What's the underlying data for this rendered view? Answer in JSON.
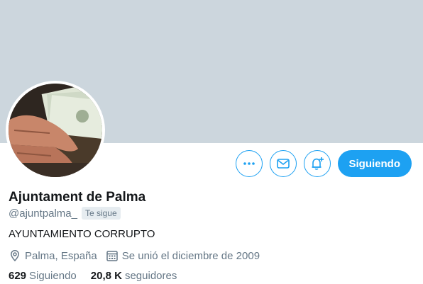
{
  "profile": {
    "name": "Ajuntament de Palma",
    "handle": "@ajuntpalma_",
    "follows_you_label": "Te sigue",
    "bio": "AYUNTAMIENTO CORRUPTO",
    "location": "Palma, España",
    "joined": "Se unió el diciembre de 2009",
    "following_count": "629",
    "following_label": "Siguiendo",
    "followers_count": "20,8 K",
    "followers_label": "seguidores"
  },
  "actions": {
    "more_icon": "more-dots-icon",
    "message_icon": "envelope-icon",
    "notify_icon": "bell-plus-icon",
    "follow_button_label": "Siguiendo"
  },
  "colors": {
    "banner": "#ccd6dd",
    "accent": "#1da1f2",
    "secondary_text": "#657786"
  }
}
